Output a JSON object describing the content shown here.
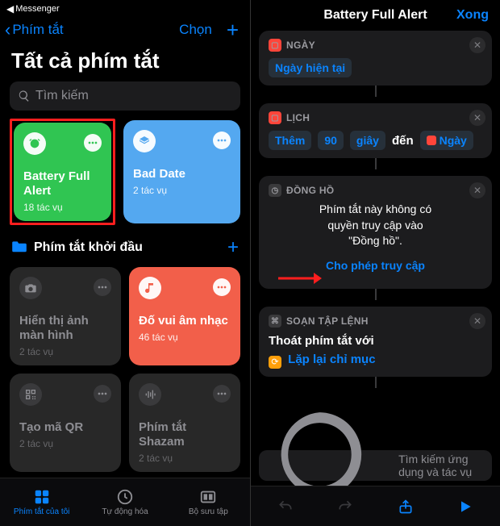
{
  "left": {
    "status_app": "Messenger",
    "back_label": "Phím tắt",
    "select_label": "Chọn",
    "page_title": "Tất cả phím tắt",
    "search_placeholder": "Tìm kiếm",
    "cards": [
      {
        "name": "Battery Full Alert",
        "sub": "18 tác vụ"
      },
      {
        "name": "Bad Date",
        "sub": "2 tác vụ"
      }
    ],
    "section_title": "Phím tắt khởi đầu",
    "starter": [
      {
        "name": "Hiển thị ảnh màn hình",
        "sub": "2 tác vụ"
      },
      {
        "name": "Đố vui âm nhạc",
        "sub": "46 tác vụ"
      },
      {
        "name": "Tạo mã QR",
        "sub": "2 tác vụ"
      },
      {
        "name": "Phím tắt Shazam",
        "sub": "2 tác vụ"
      }
    ],
    "tabs": [
      "Phím tắt của tôi",
      "Tự động hóa",
      "Bộ sưu tập"
    ]
  },
  "right": {
    "title": "Battery Full Alert",
    "done": "Xong",
    "blocks": {
      "day": {
        "head": "NGÀY",
        "token": "Ngày hiện tại"
      },
      "cal": {
        "head": "LỊCH",
        "t_add": "Thêm",
        "t_num": "90",
        "t_unit": "giây",
        "t_to": "đến",
        "t_day": "Ngày"
      },
      "clock": {
        "head": "ĐỒNG HỒ",
        "denied1": "Phím tắt này không có",
        "denied2": "quyền truy cập vào",
        "denied3": "\"Đồng hồ\".",
        "allow": "Cho phép truy cập"
      },
      "script": {
        "head": "SOẠN TẬP LỆNH",
        "line1": "Thoát phím tắt với",
        "line2": "Lặp lại chỉ mục"
      }
    },
    "search_placeholder": "Tìm kiếm ứng dụng và tác vụ"
  }
}
